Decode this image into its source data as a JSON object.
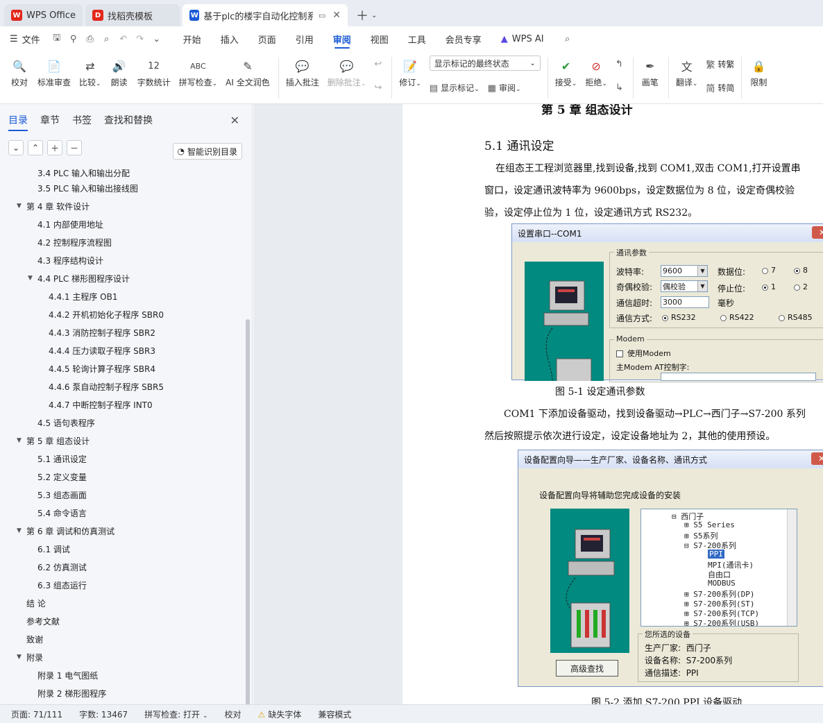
{
  "tabs": [
    {
      "label": "WPS Office",
      "icon": "wps-logo-icon"
    },
    {
      "label": "找稻壳模板",
      "icon": "docer-icon"
    },
    {
      "label": "基于plc的楼宇自动化控制系统",
      "icon": "word-doc-icon"
    }
  ],
  "menu": {
    "file": "文件",
    "tabs": [
      "开始",
      "插入",
      "页面",
      "引用",
      "审阅",
      "视图",
      "工具",
      "会员专享"
    ],
    "active": "审阅",
    "ai": "WPS AI"
  },
  "ribbon": {
    "proofread": "校对",
    "standard_review": "标准审查",
    "compare": "比较",
    "read_aloud": "朗读",
    "word_count": "字数统计",
    "spell_check": "拼写检查",
    "ai_polish": "AI 全文润色",
    "insert_comment": "插入批注",
    "delete_comment": "删除批注",
    "track_changes": "修订",
    "markup_dropdown": "显示标记的最终状态",
    "show_markup": "显示标记",
    "review": "审阅",
    "accept": "接受",
    "reject": "拒绝",
    "pen": "画笔",
    "translate": "翻译",
    "to_traditional": "转繁",
    "to_simplified": "转简",
    "restrict": "限制"
  },
  "nav": {
    "tabs": [
      "目录",
      "章节",
      "书签",
      "查找和替换"
    ],
    "smart_toc": "智能识别目录",
    "items": [
      {
        "label": "3.4   PLC 输入和输出分配",
        "level": 2
      },
      {
        "label": "3.5   PLC 输入和输出接线图",
        "level": 2
      },
      {
        "label": "第 4 章   软件设计",
        "level": 1,
        "expanded": true
      },
      {
        "label": "4.1   内部使用地址",
        "level": 2
      },
      {
        "label": "4.2   控制程序流程图",
        "level": 2
      },
      {
        "label": "4.3   程序结构设计",
        "level": 2
      },
      {
        "label": "4.4   PLC 梯形图程序设计",
        "level": 2,
        "expanded": true
      },
      {
        "label": "4.4.1  主程序 OB1",
        "level": 3
      },
      {
        "label": "4.4.2  开机初始化子程序 SBR0",
        "level": 3
      },
      {
        "label": "4.4.3 消防控制子程序 SBR2",
        "level": 3
      },
      {
        "label": "4.4.4  压力读取子程序 SBR3",
        "level": 3
      },
      {
        "label": "4.4.5  轮询计算子程序 SBR4",
        "level": 3
      },
      {
        "label": "4.4.6    泵自动控制子程序 SBR5",
        "level": 3
      },
      {
        "label": "4.4.7    中断控制子程序 INT0",
        "level": 3
      },
      {
        "label": "4.5    语句表程序",
        "level": 2
      },
      {
        "label": "第 5 章  组态设计",
        "level": 1,
        "expanded": true
      },
      {
        "label": "5.1    通讯设定",
        "level": 2
      },
      {
        "label": "5.2    定义变量",
        "level": 2
      },
      {
        "label": "5.3    组态画面",
        "level": 2
      },
      {
        "label": "5.4    命令语言",
        "level": 2
      },
      {
        "label": "第 6 章    调试和仿真测试",
        "level": 1,
        "expanded": true
      },
      {
        "label": "6.1    调试",
        "level": 2
      },
      {
        "label": "6.2    仿真测试",
        "level": 2
      },
      {
        "label": "6.3    组态运行",
        "level": 2
      },
      {
        "label": "结   论",
        "level": 1
      },
      {
        "label": "参考文献",
        "level": 1
      },
      {
        "label": "致谢",
        "level": 1
      },
      {
        "label": "附录",
        "level": 1,
        "expanded": true
      },
      {
        "label": "附录 1    电气图纸",
        "level": 2
      },
      {
        "label": "附录 2    梯形图程序",
        "level": 2
      }
    ]
  },
  "doc": {
    "chapter_title": "第 5 章  组态设计",
    "section_title": "5.1    通讯设定",
    "para1": [
      "在组态王工程浏览器里,找到设备,找到 COM1,双击 COM1,打开设置串",
      "窗口，设定通讯波特率为 9600bps，设定数据位为 8 位，设定奇偶校验",
      "验，设定停止位为 1 位，设定通讯方式 RS232。"
    ],
    "fig1_caption": "图 5-1 设定通讯参数",
    "para2": [
      "COM1 下添加设备驱动，找到设备驱动→PLC→西门子→S7-200 系列",
      "然后按照提示依次进行设定，设定设备地址为 2，其他的使用预设。"
    ],
    "fig2_caption": "图 5-2 添加 S7-200 PPI 设备驱动"
  },
  "dialog1": {
    "title": "设置串口--COM1",
    "group": "通讯参数",
    "baud_label": "波特率:",
    "baud_value": "9600",
    "parity_label": "奇偶校验:",
    "parity_value": "偶校验",
    "timeout_label": "通信超时:",
    "timeout_value": "3000",
    "timeout_unit": "毫秒",
    "databits_label": "数据位:",
    "databits_opts": [
      "7",
      "8"
    ],
    "stopbits_label": "停止位:",
    "stopbits_opts": [
      "1",
      "2"
    ],
    "mode_label": "通信方式:",
    "mode_opts": [
      "RS232",
      "RS422",
      "RS485"
    ],
    "modem_group": "Modem",
    "use_modem": "使用Modem",
    "modem_ctrl": "主Modem AT控制字:"
  },
  "dialog2": {
    "title": "设备配置向导——生产厂家、设备名称、通讯方式",
    "intro": "设备配置向导将辅助您完成设备的安装",
    "tree": [
      "西门子",
      "S5 Series",
      "S5系列",
      "S7-200系列",
      "PPI",
      "MPI(通讯卡)",
      "自由口",
      "MODBUS",
      "S7-200系列(DP)",
      "S7-200系列(ST)",
      "S7-200系列(TCP)",
      "S7-200系列(USB)"
    ],
    "advanced": "高级查找",
    "selected_group": "您所选的设备",
    "vendor_label": "生产厂家:",
    "vendor_value": "西门子",
    "device_label": "设备名称:",
    "device_value": "S7-200系列",
    "comm_label": "通信描述:",
    "comm_value": "PPI"
  },
  "status": {
    "page": "页面: 71/111",
    "words": "字数: 13467",
    "spell": "拼写检查: 打开",
    "proof": "校对",
    "missing_font": "缺失字体",
    "compat": "兼容模式"
  },
  "colors": {
    "accent": "#1a5ad6",
    "dialog_teal": "#008a80"
  }
}
